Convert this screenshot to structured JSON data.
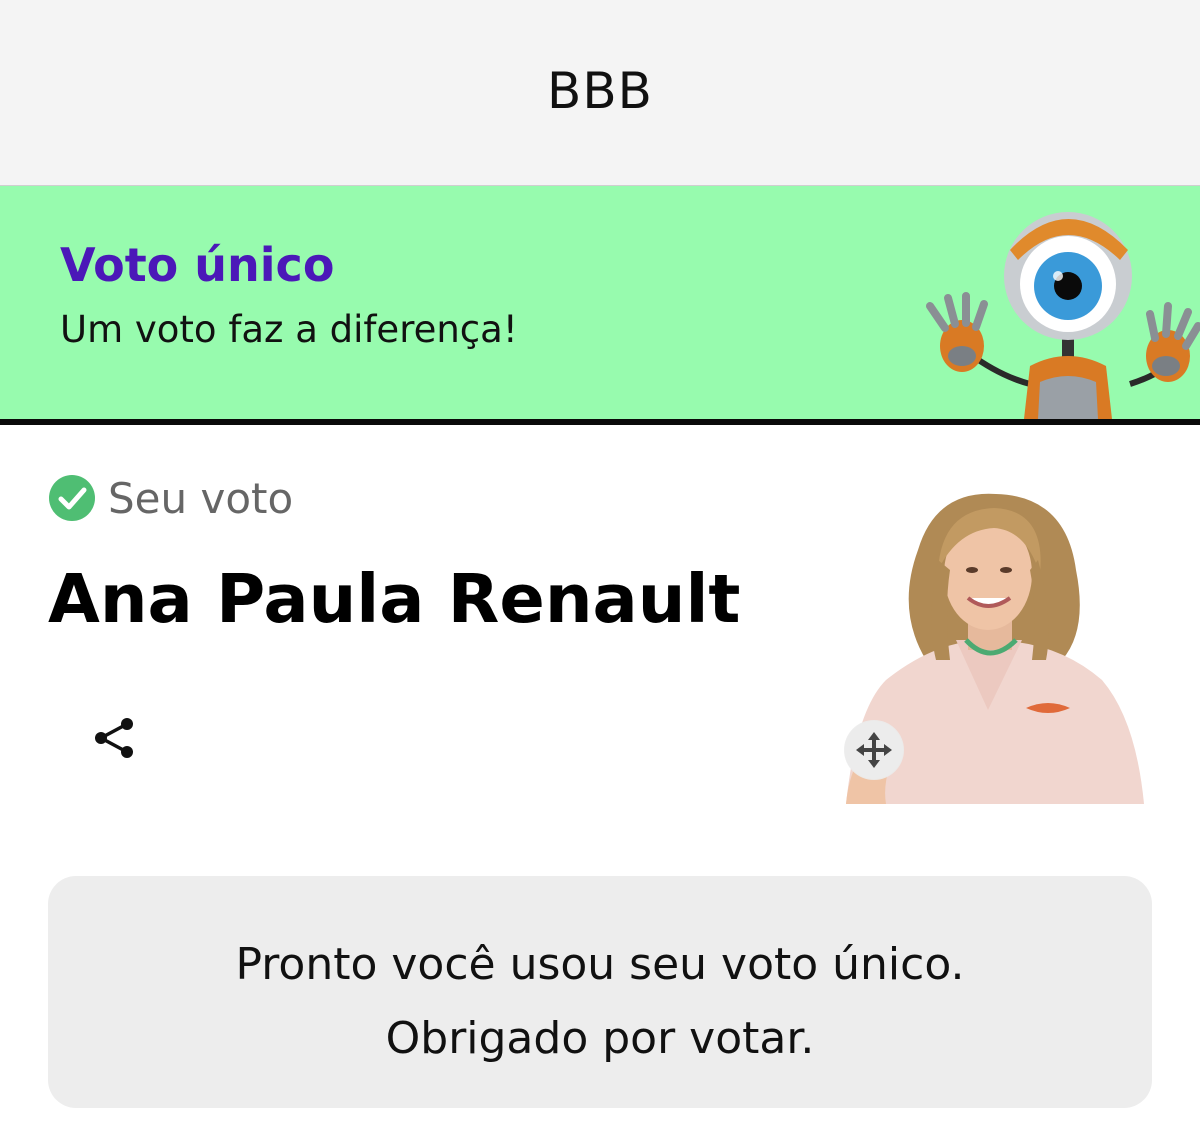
{
  "header": {
    "title": "BBB"
  },
  "banner": {
    "heading": "Voto único",
    "subheading": "Um voto faz a diferença!",
    "mascot_icon": "big-brother-eye-robot-mascot"
  },
  "vote": {
    "status_icon": "check-circle-icon",
    "status_label": "Seu voto",
    "candidate_name": "Ana Paula Renault",
    "share_icon": "share-icon",
    "photo_alt": "Ana Paula Renault",
    "move_icon": "move-arrows-icon"
  },
  "notice": {
    "line1": "Pronto você usou seu voto único.",
    "line2": "Obrigado por votar."
  },
  "colors": {
    "banner_bg": "#97fbae",
    "heading": "#4b18b8",
    "check": "#4fbe73"
  }
}
